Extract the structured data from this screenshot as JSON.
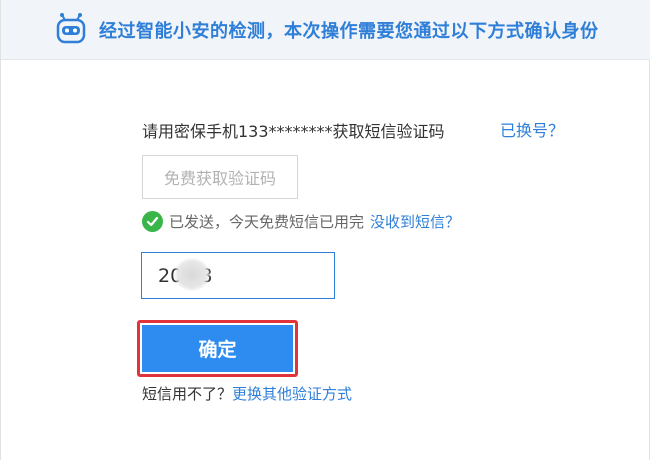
{
  "banner": {
    "text": "经过智能小安的检测，本次操作需要您通过以下方式确认身份",
    "icon": "robot-icon"
  },
  "verify": {
    "phone_prompt": "请用密保手机133********获取短信验证码",
    "switch_link": "已换号？",
    "get_code_button": "免费获取验证码",
    "sent_status": "已发送，今天免费短信已用完",
    "not_received_link": "没收到短信？",
    "code_value": "20   8",
    "confirm_button": "确定",
    "footer_question": "短信用不了？",
    "footer_link": "更换其他验证方式"
  },
  "colors": {
    "accent_blue": "#2f7fd8",
    "button_blue": "#2e8cf0",
    "success_green": "#3ab54a",
    "highlight_red": "#e0343a"
  }
}
